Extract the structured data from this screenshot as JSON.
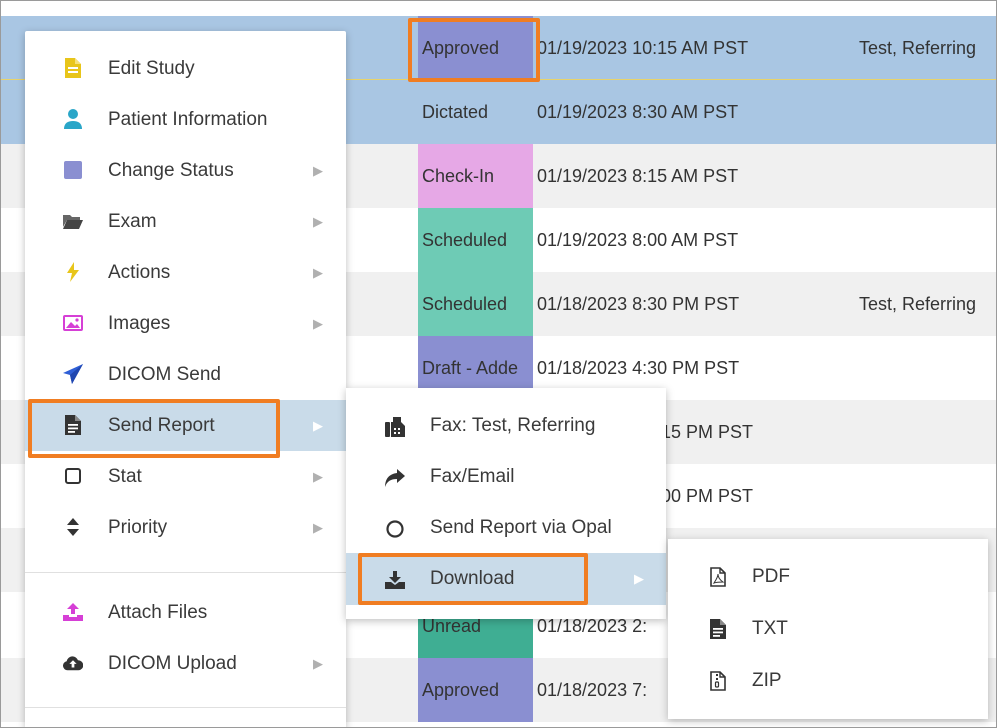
{
  "worklist": {
    "rows": [
      {
        "status": "Approved",
        "status_color": "#8a8fd1",
        "datetime": "01/19/2023 10:15 AM PST",
        "referring": "Test, Referring",
        "row_style": "selected"
      },
      {
        "status": "Dictated",
        "status_color": "#a9c6e3",
        "datetime": "01/19/2023 8:30 AM PST",
        "referring": "",
        "row_style": "selected"
      },
      {
        "status": "Check-In",
        "status_color": "#e6a8e6",
        "datetime": "01/19/2023 8:15 AM PST",
        "referring": "",
        "row_style": "alt"
      },
      {
        "status": "Scheduled",
        "status_color": "#6ecbb5",
        "datetime": "01/19/2023 8:00 AM PST",
        "referring": "",
        "row_style": "plain"
      },
      {
        "status": "Scheduled",
        "status_color": "#6ecbb5",
        "datetime": "01/18/2023 8:30 PM PST",
        "referring": "Test, Referring",
        "row_style": "alt"
      },
      {
        "status": "Draft - Adde",
        "status_color": "#8a8fd1",
        "datetime": "01/18/2023 4:30 PM PST",
        "referring": "",
        "row_style": "plain"
      },
      {
        "status": "",
        "status_color": "#ffffff",
        "datetime": ":15 PM PST",
        "referring": "",
        "row_style": "alt"
      },
      {
        "status": "",
        "status_color": "#ffffff",
        "datetime": ":00 PM PST",
        "referring": "",
        "row_style": "plain"
      },
      {
        "status": "",
        "status_color": "#ffffff",
        "datetime": "",
        "referring": "",
        "row_style": "alt"
      },
      {
        "status": "Unread",
        "status_color": "#3fae93",
        "datetime": "01/18/2023 2:",
        "referring": "",
        "row_style": "plain"
      },
      {
        "status": "Approved",
        "status_color": "#8a8fd1",
        "datetime": "01/18/2023 7:",
        "referring": "",
        "row_style": "alt"
      }
    ]
  },
  "context_menu": {
    "items": [
      {
        "label": "Edit Study",
        "icon": "edit-study-icon",
        "color": "#e8c51a",
        "submenu": false
      },
      {
        "label": "Patient Information",
        "icon": "person-icon",
        "color": "#2aa6c8",
        "submenu": false
      },
      {
        "label": "Change Status",
        "icon": "square-icon",
        "color": "#8a8fd1",
        "submenu": true
      },
      {
        "label": "Exam",
        "icon": "folder-open-icon",
        "color": "#555555",
        "submenu": true
      },
      {
        "label": "Actions",
        "icon": "bolt-icon",
        "color": "#e8c51a",
        "submenu": true
      },
      {
        "label": "Images",
        "icon": "image-icon",
        "color": "#d63fd6",
        "submenu": true
      },
      {
        "label": "DICOM Send",
        "icon": "paper-plane-icon",
        "color": "#2f5fd6",
        "submenu": false
      },
      {
        "label": "Send Report",
        "icon": "file-text-icon",
        "color": "#333333",
        "submenu": true
      },
      {
        "label": "Stat",
        "icon": "checkbox-icon",
        "color": "#333333",
        "submenu": true
      },
      {
        "label": "Priority",
        "icon": "sort-icon",
        "color": "#333333",
        "submenu": true
      },
      {
        "label": "Attach Files",
        "icon": "upload-tray-icon",
        "color": "#d63fd6",
        "submenu": false
      },
      {
        "label": "DICOM Upload",
        "icon": "cloud-upload-icon",
        "color": "#333333",
        "submenu": true
      }
    ]
  },
  "send_report_menu": {
    "items": [
      {
        "label": "Fax: Test, Referring",
        "icon": "fax-icon"
      },
      {
        "label": "Fax/Email",
        "icon": "share-arrow-icon"
      },
      {
        "label": "Send Report via Opal",
        "icon": "circle-icon"
      },
      {
        "label": "Download",
        "icon": "download-icon"
      }
    ]
  },
  "download_menu": {
    "items": [
      {
        "label": "PDF",
        "icon": "pdf-file-icon"
      },
      {
        "label": "TXT",
        "icon": "text-file-icon"
      },
      {
        "label": "ZIP",
        "icon": "zip-file-icon"
      }
    ]
  },
  "colors": {
    "highlight": "#f07d22",
    "selected_row": "#a9c6e3",
    "active_menu": "#c9dbe9"
  }
}
